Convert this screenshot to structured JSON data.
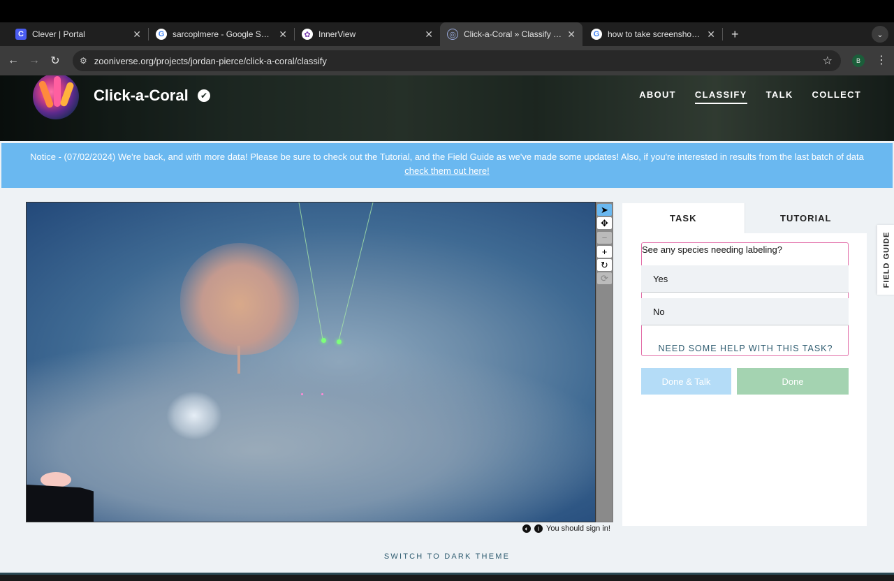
{
  "browser": {
    "tabs": [
      {
        "title": "Clever | Portal",
        "favicon": "C",
        "favicon_color": "#4a5cf0",
        "active": false
      },
      {
        "title": "sarcoplmere - Google Search",
        "favicon": "G",
        "favicon_color": "#ffffff",
        "active": false
      },
      {
        "title": "InnerView",
        "favicon": "✿",
        "favicon_color": "#ffffff",
        "active": false
      },
      {
        "title": "Click-a-Coral » Classify — Zo",
        "favicon": "◎",
        "favicon_color": "#3c3c3c",
        "active": true
      },
      {
        "title": "how to take screenshot on m",
        "favicon": "G",
        "favicon_color": "#ffffff",
        "active": false
      }
    ],
    "new_tab": "+",
    "tab_menu": "⌄",
    "url": "zooniverse.org/projects/jordan-pierce/click-a-coral/classify",
    "profile_initial": "B"
  },
  "project": {
    "title": "Click-a-Coral",
    "verified": "✔",
    "nav": [
      {
        "label": "ABOUT",
        "active": false
      },
      {
        "label": "CLASSIFY",
        "active": true
      },
      {
        "label": "TALK",
        "active": false
      },
      {
        "label": "COLLECT",
        "active": false
      }
    ]
  },
  "notice": {
    "text": "Notice - (07/02/2024) We're back, and with more data! Please be sure to check out the Tutorial, and the Field Guide as we've made some updates! Also, if you're interested in results from the last batch of data",
    "link": "check them out here!"
  },
  "toolbar": [
    "pointer-icon",
    "move-icon",
    "zoom-out-icon",
    "zoom-in-icon",
    "rotate-icon",
    "reset-icon"
  ],
  "signin": {
    "text": "You should sign in!"
  },
  "task": {
    "tabs": [
      {
        "label": "TASK"
      },
      {
        "label": "TUTORIAL"
      }
    ],
    "question": "See any species needing labeling?",
    "answers": [
      "Yes",
      "No"
    ],
    "help": "NEED SOME HELP WITH THIS TASK?",
    "done_talk": "Done & Talk",
    "done": "Done"
  },
  "field_guide": "FIELD GUIDE",
  "dark_theme": "SWITCH TO DARK THEME",
  "colors": {
    "notice": "#6ab8f0",
    "task_border": "#e26ea8",
    "done": "#a4d3b1",
    "done_talk": "#b4dcf7"
  }
}
